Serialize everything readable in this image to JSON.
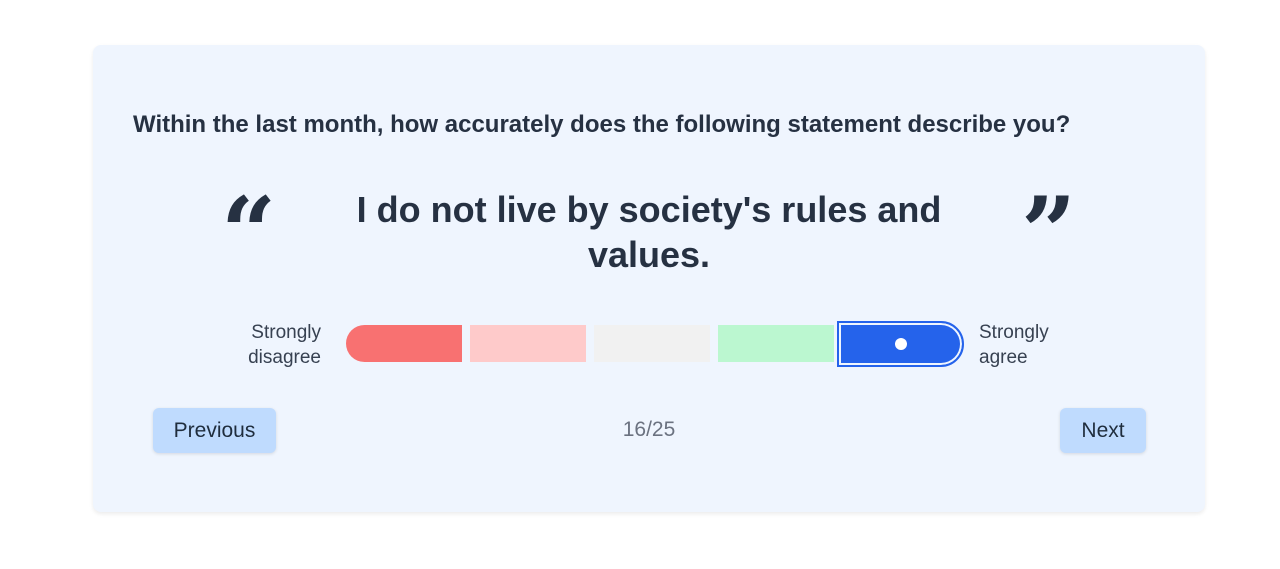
{
  "survey": {
    "question": "Within the last month, how accurately does the following statement describe you?",
    "statement": "I do not live by society's rules and values.",
    "quote_open": "“",
    "quote_close": "”"
  },
  "scale": {
    "left_label": "Strongly disagree",
    "right_label": "Strongly agree",
    "selected_index": 5,
    "options": [
      {
        "color": "#f87171"
      },
      {
        "color": "#fecaca"
      },
      {
        "color": "#f1f1f1"
      },
      {
        "color": "#bbf7d0"
      },
      {
        "color": "#2563eb"
      }
    ]
  },
  "navigation": {
    "previous_label": "Previous",
    "next_label": "Next",
    "progress": "16/25"
  }
}
